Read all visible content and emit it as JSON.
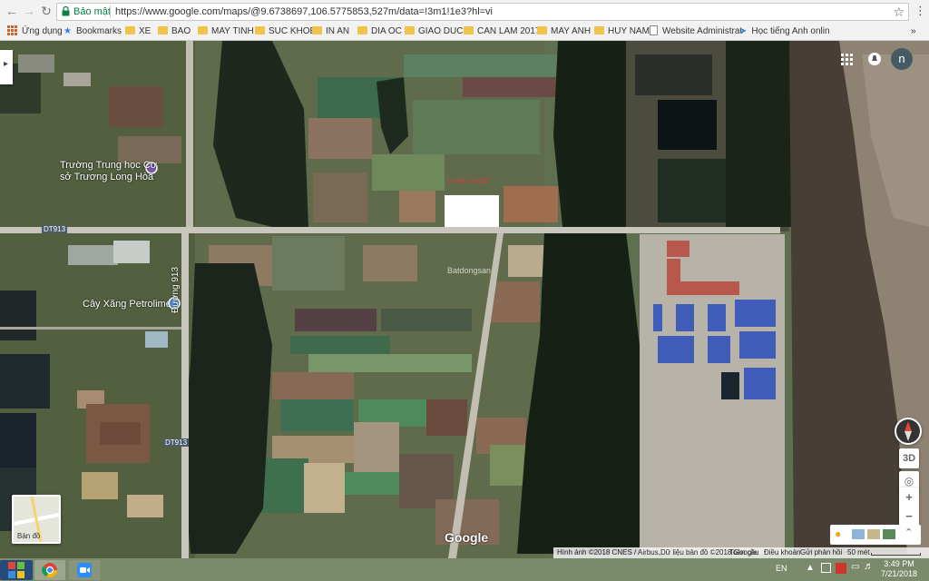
{
  "browser": {
    "secure_label": "Bảo mật",
    "url": "https://www.google.com/maps/@9.6738697,106.5775853,527m/data=!3m1!1e3?hl=vi",
    "bookmarks": [
      "Ứng dụng",
      "Bookmarks",
      "XE",
      "BAO",
      "MAY TINH",
      "SUC KHOE",
      "IN AN",
      "DIA OC",
      "GIAO DUC",
      "CAN LAM 2017",
      "MAY ANH",
      "HUY NAM",
      "Website Administrat",
      "Học tiếng Anh onlin"
    ],
    "more_bookmarks": "»"
  },
  "map": {
    "labels": {
      "school_line1": "Trường Trung học Cơ",
      "school_line2": "sở Trương Long Hòa",
      "gas_station": "Cây Xăng Petrolimex",
      "road_d913_a": "DT913",
      "road_d913_b": "DT913",
      "road_vertical": "Đường 913",
      "plot_label": "VỊ TRÍ LÔ ĐẤT",
      "watermark": "Batdongsan"
    },
    "user_initial": "n",
    "layer_toggle_label": "Bản đồ",
    "google_logo": "Google",
    "attribution": "Hình ảnh ©2018 CNES / Airbus,Dữ liệu bản đồ ©2018 Google",
    "links": [
      "Toàn cầu",
      "Điều khoản",
      "Gửi phản hồi"
    ],
    "scale": "50 mét",
    "controls": {
      "threed": "3D",
      "zoom_in": "+",
      "zoom_out": "−"
    }
  },
  "taskbar": {
    "language": "EN",
    "time": "3:49 PM",
    "date": "7/21/2018"
  }
}
